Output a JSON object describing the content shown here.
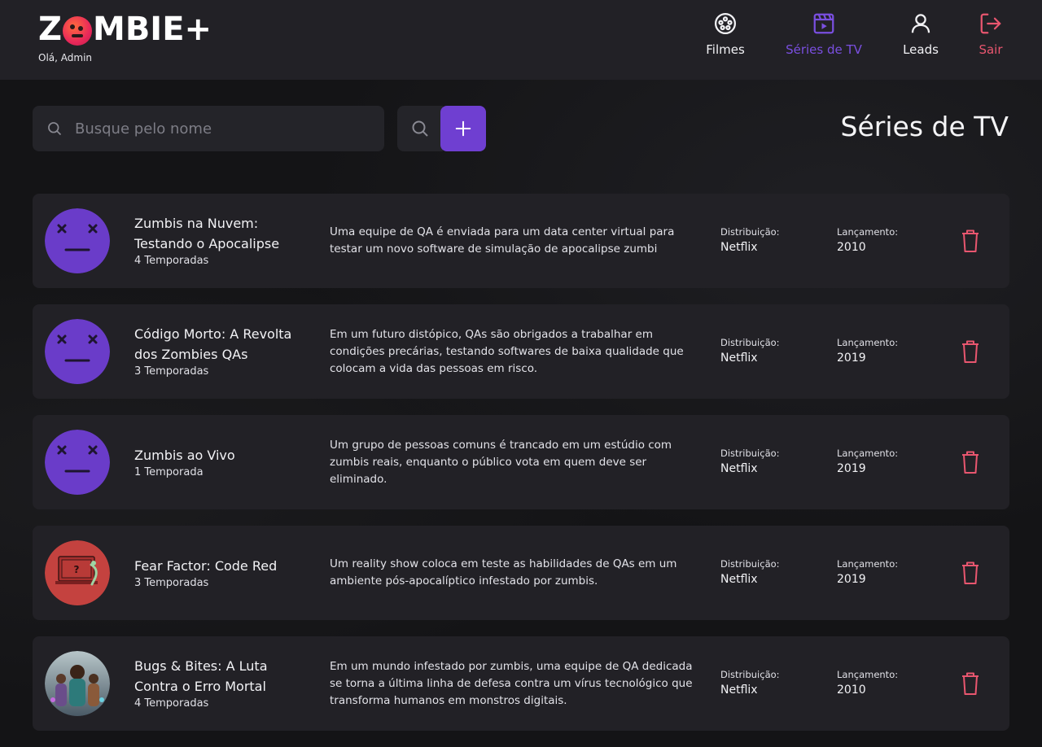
{
  "header": {
    "logo_text_left": "Z",
    "logo_text_right": "MBIE+",
    "greeting": "Olá, Admin",
    "nav": [
      {
        "label": "Filmes",
        "icon": "film-reel-icon"
      },
      {
        "label": "Séries de TV",
        "icon": "clapperboard-icon",
        "active": true
      },
      {
        "label": "Leads",
        "icon": "user-icon"
      },
      {
        "label": "Sair",
        "icon": "logout-icon"
      }
    ]
  },
  "toolbar": {
    "search_placeholder": "Busque pelo nome",
    "search_value": "",
    "search_button_icon": "search-icon",
    "add_button_icon": "plus-icon"
  },
  "page_title": "Séries de TV",
  "colors": {
    "accent": "#6f3fd1",
    "active_nav": "#7a4fe0",
    "danger": "#e8566f",
    "card_bg": "#222126",
    "page_bg": "#141416"
  },
  "labels": {
    "distribution": "Distribuição:",
    "release": "Lançamento:"
  },
  "series": [
    {
      "title": "Zumbis na Nuvem: Testando o Apocalipse",
      "seasons": "4 Temporadas",
      "description": "Uma equipe de QA é enviada para um data center virtual para testar um novo software de simulação de apocalipse zumbi",
      "distribution": "Netflix",
      "release": "2010",
      "thumb": "placeholder-face"
    },
    {
      "title": "Código Morto: A Revolta dos Zombies QAs",
      "seasons": "3 Temporadas",
      "description": "Em um futuro distópico, QAs são obrigados a trabalhar em condições precárias, testando softwares de baixa qualidade que colocam a vida das pessoas em risco.",
      "distribution": "Netflix",
      "release": "2019",
      "thumb": "placeholder-face"
    },
    {
      "title": "Zumbis ao Vivo",
      "seasons": "1 Temporada",
      "description": "Um grupo de pessoas comuns é trancado em um estúdio com zumbis reais, enquanto o público vota em quem deve ser eliminado.",
      "distribution": "Netflix",
      "release": "2019",
      "thumb": "placeholder-face"
    },
    {
      "title": "Fear Factor: Code Red",
      "seasons": "3 Temporadas",
      "description": "Um reality show coloca em teste as habilidades de QAs em um ambiente pós-apocalíptico infestado por zumbis.",
      "distribution": "Netflix",
      "release": "2019",
      "thumb": "fear-factor-cover"
    },
    {
      "title": "Bugs & Bites: A Luta Contra o Erro Mortal",
      "seasons": "4 Temporadas",
      "description": "Em um mundo infestado por zumbis, uma equipe de QA dedicada se torna a última linha de defesa contra um vírus tecnológico que transforma humanos em monstros digitais.",
      "distribution": "Netflix",
      "release": "2010",
      "thumb": "group-poster-cover"
    }
  ]
}
